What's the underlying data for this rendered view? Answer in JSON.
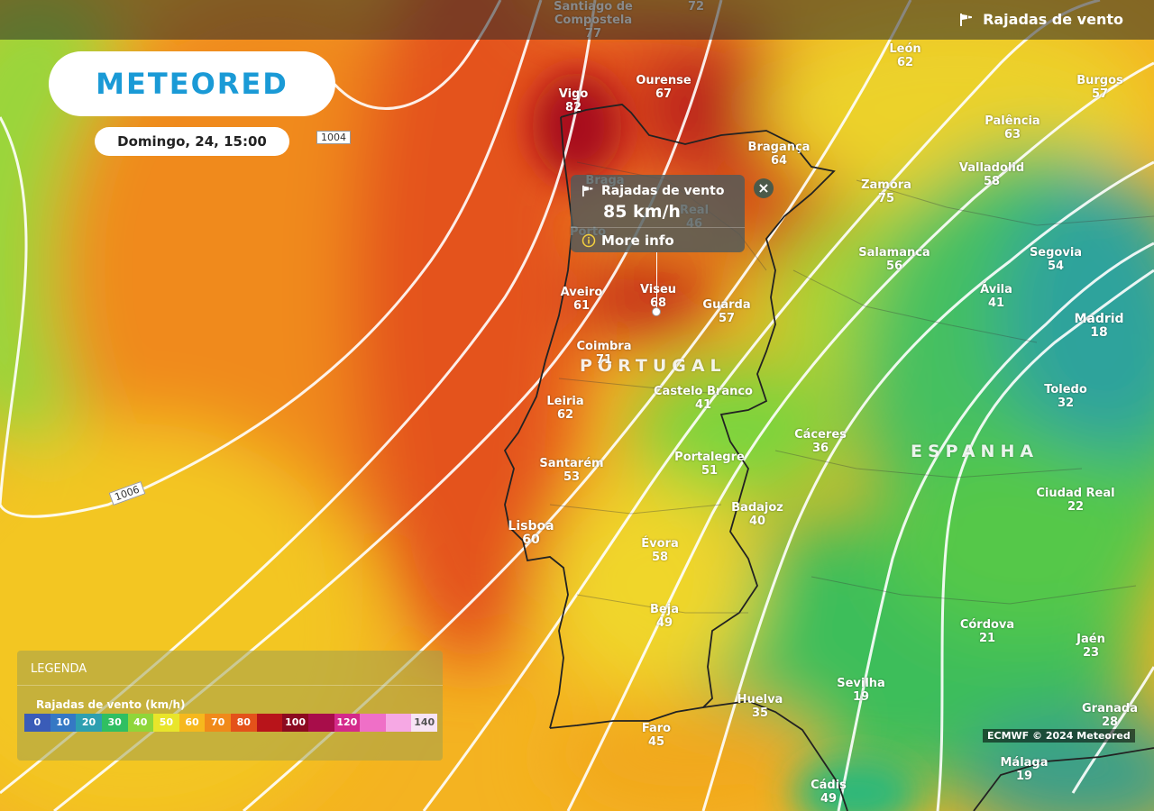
{
  "header": {
    "layer_label": "Rajadas de vento",
    "icon": "windsock-icon"
  },
  "logo": {
    "text": "METEORED"
  },
  "date": "Domingo, 24, 15:00",
  "popup": {
    "title": "Rajadas de vento",
    "value": "85 km/h",
    "more_label": "More info",
    "close_icon": "close-icon"
  },
  "isobars": [
    {
      "label": "1004"
    },
    {
      "label": "1006"
    }
  ],
  "countries": {
    "portugal": "PORTUGAL",
    "espanha": "ESPANHA"
  },
  "cities": [
    {
      "name": "Santiago de\nCompostela",
      "value": "77"
    },
    {
      "name": "",
      "value": "72"
    },
    {
      "name": "Vigo",
      "value": "82"
    },
    {
      "name": "Ourense",
      "value": "67"
    },
    {
      "name": "León",
      "value": "62"
    },
    {
      "name": "Burgos",
      "value": "57"
    },
    {
      "name": "Palência",
      "value": "63"
    },
    {
      "name": "Bragança",
      "value": "64"
    },
    {
      "name": "Valladolid",
      "value": "58"
    },
    {
      "name": "Zamora",
      "value": "75"
    },
    {
      "name": "Braga",
      "value": ""
    },
    {
      "name": "Real",
      "value": "46"
    },
    {
      "name": "Porto",
      "value": ""
    },
    {
      "name": "Salamanca",
      "value": "56"
    },
    {
      "name": "Segovia",
      "value": "54"
    },
    {
      "name": "Aveiro",
      "value": "61"
    },
    {
      "name": "Viseu",
      "value": "68"
    },
    {
      "name": "Guarda",
      "value": "57"
    },
    {
      "name": "Ávila",
      "value": "41"
    },
    {
      "name": "Madrid",
      "value": "18"
    },
    {
      "name": "Coimbra",
      "value": "71"
    },
    {
      "name": "Castelo Branco",
      "value": "41"
    },
    {
      "name": "Toledo",
      "value": "32"
    },
    {
      "name": "Leiria",
      "value": "62"
    },
    {
      "name": "Cáceres",
      "value": "36"
    },
    {
      "name": "Santarém",
      "value": "53"
    },
    {
      "name": "Portalegre",
      "value": "51"
    },
    {
      "name": "Badajoz",
      "value": "40"
    },
    {
      "name": "Ciudad Real",
      "value": "22"
    },
    {
      "name": "Lisboa",
      "value": "60"
    },
    {
      "name": "Évora",
      "value": "58"
    },
    {
      "name": "Beja",
      "value": "49"
    },
    {
      "name": "Córdova",
      "value": "21"
    },
    {
      "name": "Jaén",
      "value": "23"
    },
    {
      "name": "Sevilha",
      "value": "19"
    },
    {
      "name": "Huelva",
      "value": "35"
    },
    {
      "name": "Granada",
      "value": "28"
    },
    {
      "name": "Faro",
      "value": "45"
    },
    {
      "name": "Málaga",
      "value": "19"
    },
    {
      "name": "Cádis",
      "value": "49"
    }
  ],
  "legend": {
    "title": "LEGENDA",
    "subtitle": "Rajadas de vento (km/h)",
    "stops": [
      {
        "label": "0",
        "color": "#3a5cb8"
      },
      {
        "label": "10",
        "color": "#3578c4"
      },
      {
        "label": "20",
        "color": "#2e9fb0"
      },
      {
        "label": "30",
        "color": "#2fbf62"
      },
      {
        "label": "40",
        "color": "#8fd63a"
      },
      {
        "label": "50",
        "color": "#e9e52a"
      },
      {
        "label": "60",
        "color": "#f6b81d"
      },
      {
        "label": "70",
        "color": "#f08a1a"
      },
      {
        "label": "80",
        "color": "#e4521a"
      },
      {
        "label": "",
        "color": "#b8141a"
      },
      {
        "label": "100",
        "color": "#8c0a20"
      },
      {
        "label": "",
        "color": "#a80d4a"
      },
      {
        "label": "120",
        "color": "#d42a8a"
      },
      {
        "label": "",
        "color": "#ef6fc7"
      },
      {
        "label": "",
        "color": "#f6a8e4"
      },
      {
        "label": "140",
        "color": "#f7e4f5"
      }
    ]
  },
  "credit": "ECMWF © 2024 Meteored"
}
